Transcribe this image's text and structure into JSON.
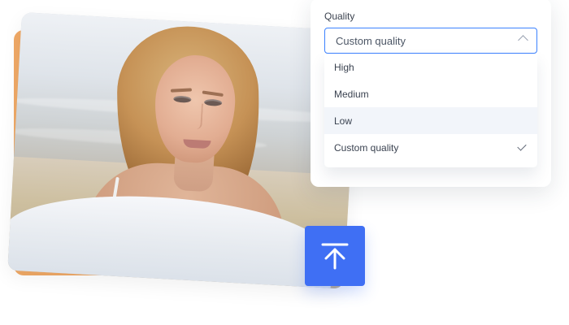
{
  "dropdown": {
    "label": "Quality",
    "selected_value": "Custom quality",
    "options": [
      {
        "label": "High"
      },
      {
        "label": "Medium"
      },
      {
        "label": "Low"
      },
      {
        "label": "Custom quality"
      }
    ],
    "highlighted_option": "Low",
    "checked_option": "Custom quality"
  },
  "icons": {
    "dropdown": "chevron-up-icon",
    "checked": "checkmark-icon",
    "upload": "upload-arrow-icon"
  },
  "colors": {
    "accent": "#3f6ff4",
    "select_border": "#3c82ff",
    "photo_backing": "#f0a966",
    "highlight_row": "#f2f5fa"
  }
}
